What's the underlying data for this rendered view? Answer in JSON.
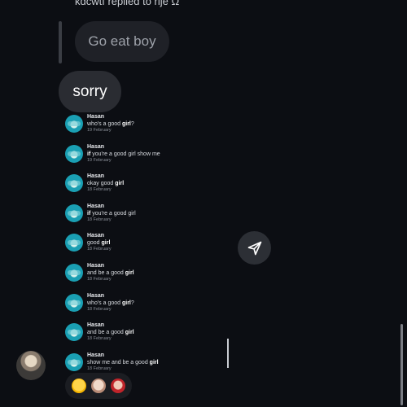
{
  "reply": {
    "label": "kdcwtf replied to rije Ω",
    "quoted_text": "Go eat boy"
  },
  "message": {
    "text": "sorry"
  },
  "search_results": [
    {
      "name": "Hasan",
      "pre": "who's a good ",
      "bold": "girl",
      "post": "?",
      "date": "19 February"
    },
    {
      "name": "Hasan",
      "pre": "",
      "bold": "if",
      "post": " you're a good girl show me",
      "date": "19 February"
    },
    {
      "name": "Hasan",
      "pre": "okay good ",
      "bold": "girl",
      "post": "",
      "date": "18 February"
    },
    {
      "name": "Hasan",
      "pre": "",
      "bold": "if",
      "post": " you're a good girl",
      "date": "18 February"
    },
    {
      "name": "Hasan",
      "pre": "good ",
      "bold": "girl",
      "post": "",
      "date": "18 February"
    },
    {
      "name": "Hasan",
      "pre": "and be a good ",
      "bold": "girl",
      "post": "",
      "date": "18 February"
    },
    {
      "name": "Hasan",
      "pre": "who's a good ",
      "bold": "girl",
      "post": "?",
      "date": "18 February"
    },
    {
      "name": "Hasan",
      "pre": "and be a good ",
      "bold": "girl",
      "post": "",
      "date": "18 February"
    },
    {
      "name": "Hasan",
      "pre": "show me and be a good ",
      "bold": "girl",
      "post": "",
      "date": "18 February"
    }
  ],
  "icons": {
    "send": "send-icon",
    "reactions": [
      "crying-emoji",
      "profile-avatar",
      "profile-avatar"
    ]
  },
  "colors": {
    "background": "#0c0e13",
    "bubble": "#2a2c32",
    "text": "#ffffff"
  }
}
